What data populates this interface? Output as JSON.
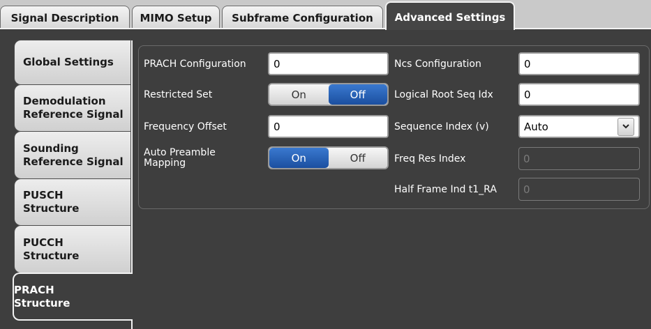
{
  "top_tabs": [
    {
      "label": "Signal Description"
    },
    {
      "label": "MIMO Setup"
    },
    {
      "label": "Subframe Configuration"
    },
    {
      "label": "Advanced Settings"
    }
  ],
  "side_tabs": [
    {
      "label": "Global Settings"
    },
    {
      "label": "Demodulation Reference Signal"
    },
    {
      "label": "Sounding Reference Signal"
    },
    {
      "label": "PUSCH Structure"
    },
    {
      "label": "PUCCH Structure"
    },
    {
      "label": "PRACH Structure"
    }
  ],
  "form": {
    "prach_configuration": {
      "label": "PRACH Configuration",
      "value": "0"
    },
    "restricted_set": {
      "label": "Restricted Set",
      "on": "On",
      "off": "Off",
      "selected": "Off"
    },
    "frequency_offset": {
      "label": "Frequency Offset",
      "value": "0"
    },
    "auto_preamble_mapping": {
      "label": "Auto Preamble Mapping",
      "on": "On",
      "off": "Off",
      "selected": "On"
    },
    "ncs_configuration": {
      "label": "Ncs Configuration",
      "value": "0"
    },
    "logical_root_seq_idx": {
      "label": "Logical Root Seq Idx",
      "value": "0"
    },
    "sequence_index": {
      "label": "Sequence Index (v)",
      "value": "Auto"
    },
    "freq_res_index": {
      "label": "Freq Res Index",
      "value": "0"
    },
    "half_frame_ind": {
      "label": "Half Frame Ind t1_RA",
      "value": "0"
    }
  },
  "colors": {
    "panel_bg": "#3e3e3e",
    "toggle_selected": "#1f57ad",
    "outer_bg": "#c9c9c9"
  },
  "icons": {
    "dropdown": "chevron-down-icon"
  }
}
